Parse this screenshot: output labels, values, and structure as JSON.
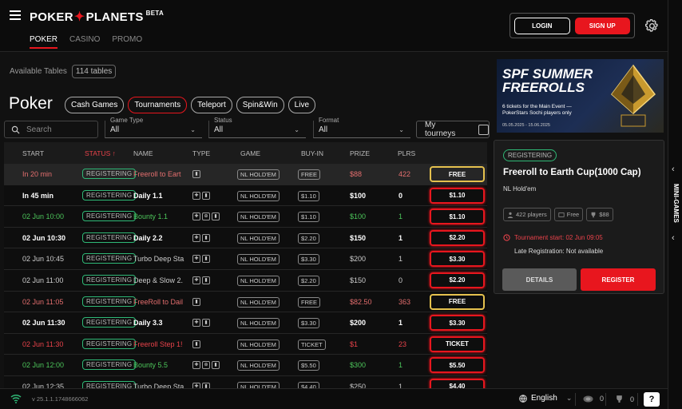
{
  "header": {
    "logo_left": "POKER",
    "logo_star": "✦",
    "logo_right": "PLANETS",
    "logo_beta": "BETA",
    "nav": [
      "POKER",
      "CASINO",
      "PROMO"
    ],
    "login": "LOGIN",
    "signup": "SIGN UP",
    "accent": "#e8161e"
  },
  "lobby": {
    "available_label": "Available Tables",
    "available_count": "114 tables",
    "title": "Poker",
    "tabs": [
      "Cash Games",
      "Tournaments",
      "Teleport",
      "Spin&Win",
      "Live"
    ],
    "active_tab": "Tournaments",
    "search_placeholder": "Search",
    "filters": [
      {
        "label": "Game Type",
        "value": "All"
      },
      {
        "label": "Status",
        "value": "All"
      },
      {
        "label": "Format",
        "value": "All"
      }
    ],
    "my_tourneys": "My tourneys"
  },
  "table": {
    "columns": [
      "START",
      "STATUS ↑",
      "NAME",
      "TYPE",
      "GAME",
      "BUY-IN",
      "PRIZE",
      "PLRS"
    ],
    "rows": [
      {
        "start": "In 20 min",
        "status": "REGISTERING",
        "name": "Freeroll to Eart",
        "type": [
          "ticket"
        ],
        "game": "NL HOLD'EM",
        "buyin": "FREE",
        "prize": "$88",
        "plrs": "422",
        "action": "FREE",
        "color": "pink",
        "btn": "gold",
        "sel": true
      },
      {
        "start": "In 45 min",
        "status": "REGISTERING",
        "name": "Daily 1.1",
        "type": [
          "bounty",
          "ticket"
        ],
        "game": "NL HOLD'EM",
        "buyin": "$1.10",
        "prize": "$100",
        "plrs": "0",
        "action": "$1.10",
        "color": "white",
        "btn": "red",
        "bold": true
      },
      {
        "start": "02 Jun 10:00",
        "status": "REGISTERING",
        "name": "Bounty 1.1",
        "type": [
          "bounty",
          "cross",
          "ticket"
        ],
        "game": "NL HOLD'EM",
        "buyin": "$1.10",
        "prize": "$100",
        "plrs": "1",
        "action": "$1.10",
        "color": "green",
        "btn": "red"
      },
      {
        "start": "02 Jun 10:30",
        "status": "REGISTERING",
        "name": "Daily 2.2",
        "type": [
          "bounty",
          "ticket"
        ],
        "game": "NL HOLD'EM",
        "buyin": "$2.20",
        "prize": "$150",
        "plrs": "1",
        "action": "$2.20",
        "color": "white",
        "btn": "red",
        "bold": true
      },
      {
        "start": "02 Jun 10:45",
        "status": "REGISTERING",
        "name": "Turbo Deep Sta",
        "type": [
          "bounty",
          "ticket"
        ],
        "game": "NL HOLD'EM",
        "buyin": "$3.30",
        "prize": "$200",
        "plrs": "1",
        "action": "$3.30",
        "color": "gray",
        "btn": "red"
      },
      {
        "start": "02 Jun 11:00",
        "status": "REGISTERING",
        "name": "Deep & Slow 2.",
        "type": [
          "bounty",
          "ticket"
        ],
        "game": "NL HOLD'EM",
        "buyin": "$2.20",
        "prize": "$150",
        "plrs": "0",
        "action": "$2.20",
        "color": "gray",
        "btn": "red"
      },
      {
        "start": "02 Jun 11:05",
        "status": "REGISTERING",
        "name": "FreeRoll to Dail",
        "type": [
          "ticket"
        ],
        "game": "NL HOLD'EM",
        "buyin": "FREE",
        "prize": "$82.50",
        "plrs": "363",
        "action": "FREE",
        "color": "pink",
        "btn": "gold"
      },
      {
        "start": "02 Jun 11:30",
        "status": "REGISTERING",
        "name": "Daily 3.3",
        "type": [
          "bounty",
          "ticket"
        ],
        "game": "NL HOLD'EM",
        "buyin": "$3.30",
        "prize": "$200",
        "plrs": "1",
        "action": "$3.30",
        "color": "white",
        "btn": "red",
        "bold": true
      },
      {
        "start": "02 Jun 11:30",
        "status": "REGISTERING",
        "name": "Freeroll Step 1!",
        "type": [
          "ticket"
        ],
        "game": "NL HOLD'EM",
        "buyin": "TICKET",
        "prize": "$1",
        "plrs": "23",
        "action": "TICKET",
        "color": "red",
        "btn": "wred"
      },
      {
        "start": "02 Jun 12:00",
        "status": "REGISTERING",
        "name": "Bounty 5.5",
        "type": [
          "bounty",
          "cross",
          "ticket"
        ],
        "game": "NL HOLD'EM",
        "buyin": "$5.50",
        "prize": "$300",
        "plrs": "1",
        "action": "$5.50",
        "color": "green",
        "btn": "red"
      },
      {
        "start": "02 Jun 12:35",
        "status": "REGISTERING",
        "name": "Turbo Deep Sta",
        "type": [
          "bounty",
          "ticket"
        ],
        "game": "NL HOLD'EM",
        "buyin": "$4.40",
        "prize": "$250",
        "plrs": "1",
        "action": "$4.40",
        "color": "gray",
        "btn": "red"
      }
    ]
  },
  "banner": {
    "title1": "SPF SUMMER",
    "title2": "FREEROLLS",
    "line1": "6 tickets for the Main Event —",
    "line2": "PokerStars Sochi players only",
    "dates": "05.05.2025 - 15.06.2025"
  },
  "detail": {
    "status": "REGISTERING",
    "title": "Freeroll to Earth Cup(1000 Cap)",
    "game": "NL Hold'em",
    "players": "422 players",
    "buyin": "Free",
    "prize": "$88",
    "start": "Tournament start: 02 Jun 09:05",
    "late": "Late Registration: Not available",
    "details_btn": "DETAILS",
    "register_btn": "REGISTER"
  },
  "side": {
    "label": "MINI-GAMES"
  },
  "footer": {
    "version": "v 25.1.1.1748666062",
    "language": "English",
    "count1": "0",
    "count2": "0",
    "help": "?"
  }
}
